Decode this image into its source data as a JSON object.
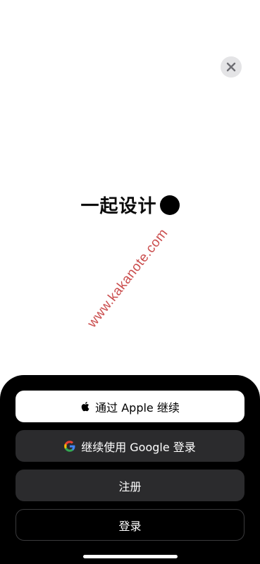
{
  "header": {
    "close_icon": "close-icon"
  },
  "brand": {
    "title": "一起设计",
    "dot_color": "#000000"
  },
  "watermark": {
    "text": "www.kakanote.com"
  },
  "auth": {
    "apple_label": "通过 Apple 继续",
    "apple_icon": "apple-icon",
    "google_label": "继续使用 Google 登录",
    "google_icon": "google-icon",
    "signup_label": "注册",
    "login_label": "登录"
  },
  "colors": {
    "sheet_bg": "#000000",
    "secondary_button": "#2b2b2d",
    "primary_button": "#ffffff",
    "watermark": "#c53a3a"
  }
}
